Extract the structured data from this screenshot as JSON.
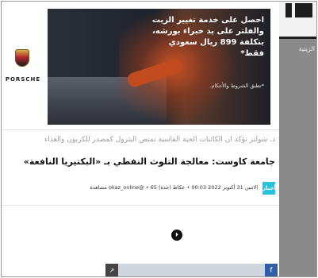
{
  "brand": {
    "name": "PORSCHE"
  },
  "banner": {
    "headline_lines": [
      "احصل على خدمة تغيير الزيت",
      "والفلتر على يد خبراء بورشه،",
      "بتكلفة 899 ريال سعودي فقط*"
    ],
    "terms": "*تطبق الشروط والأحكام."
  },
  "sidebar": {
    "label": "الزيتية"
  },
  "article": {
    "ticker": "د. شولتز تؤكد أن الكائنات الحية القاسية تمتص البترول كمصدر للكربون والغذاء",
    "headline": "جامعة كاوست: معالجة التلوث النفطي بـ «البكتيريا النافعة»",
    "tag": "أخبار",
    "meta": "الاثنين 31 أكتوبر 2022 00:03 • عكاظ (جدة) okaz_online@ • 65 مشاهدة"
  },
  "media": {
    "play_symbol": "⏵"
  },
  "colors": {
    "accent": "#27c2e0",
    "sidebar": "#8a8a8a",
    "facebook": "#2f5ea6"
  }
}
